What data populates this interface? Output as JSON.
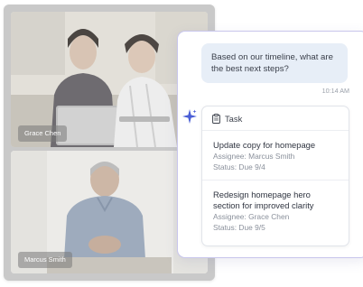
{
  "participants": [
    {
      "name": "Grace Chen"
    },
    {
      "name": "Marcus Smith"
    }
  ],
  "chat": {
    "user_message": "Based on our timeline, what are the best next steps?",
    "timestamp": "10:14 AM",
    "task_card": {
      "header_icon": "clipboard-icon",
      "header_label": "Task",
      "tasks": [
        {
          "title": "Update copy for homepage",
          "assignee": "Assignee: Marcus Smith",
          "status": "Status: Due 9/4"
        },
        {
          "title": "Redesign homepage hero section for improved clarity",
          "assignee": "Assignee: Grace Chen",
          "status": "Status: Due 9/5"
        }
      ]
    }
  },
  "colors": {
    "accent": "#4b5fd6",
    "bubble": "#e7eef7",
    "card_border": "#c8c6ec"
  },
  "icons": {
    "assistant": "sparkle-icon"
  }
}
